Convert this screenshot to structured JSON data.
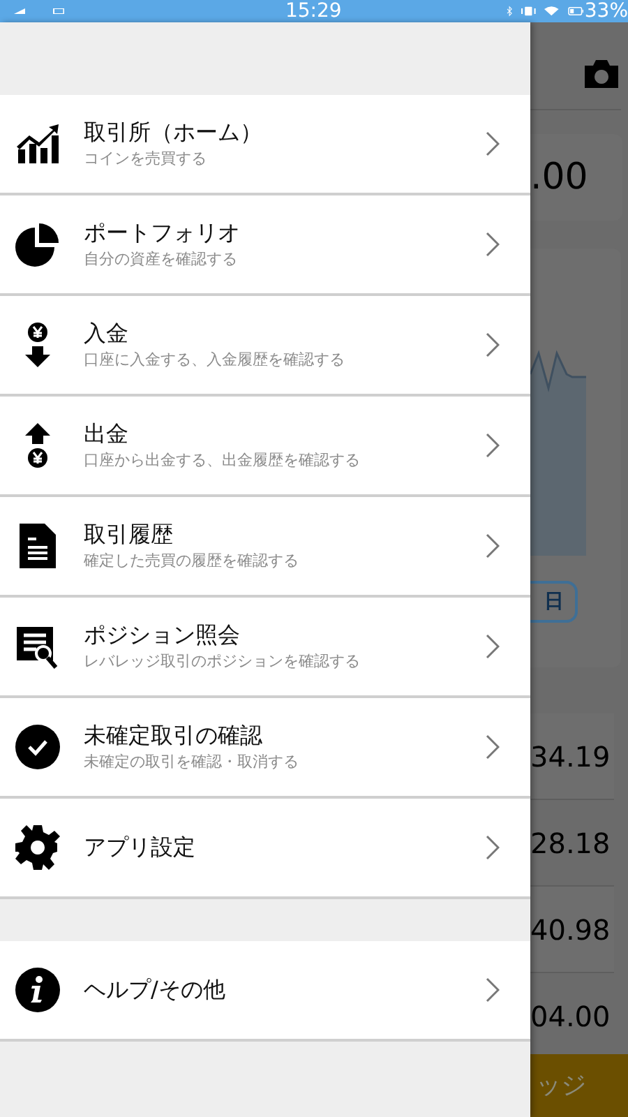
{
  "status_bar": {
    "time": "15:29",
    "battery": "33%"
  },
  "drawer": {
    "groups": [
      [
        {
          "kind": "chart",
          "title": "取引所（ホーム）",
          "subtitle": "コインを売買する"
        },
        {
          "kind": "pie",
          "title": "ポートフォリオ",
          "subtitle": "自分の資産を確認する"
        },
        {
          "kind": "deposit",
          "title": "入金",
          "subtitle": "口座に入金する、入金履歴を確認する"
        },
        {
          "kind": "withdraw",
          "title": "出金",
          "subtitle": "口座から出金する、出金履歴を確認する"
        },
        {
          "kind": "document",
          "title": "取引履歴",
          "subtitle": "確定した売買の履歴を確認する"
        },
        {
          "kind": "list",
          "title": "ポジション照会",
          "subtitle": "レバレッジ取引のポジションを確認する"
        },
        {
          "kind": "check",
          "title": "未確定取引の確認",
          "subtitle": "未確定の取引を確認・取消する"
        },
        {
          "kind": "settings",
          "title": "アプリ設定"
        }
      ],
      [
        {
          "kind": "info",
          "title": "ヘルプ/その他"
        }
      ]
    ]
  },
  "background": {
    "price": ".00",
    "range_button": "日",
    "rows": [
      "34.19",
      "28.18",
      "40.98",
      "04.00"
    ],
    "footer": "ッジ"
  }
}
